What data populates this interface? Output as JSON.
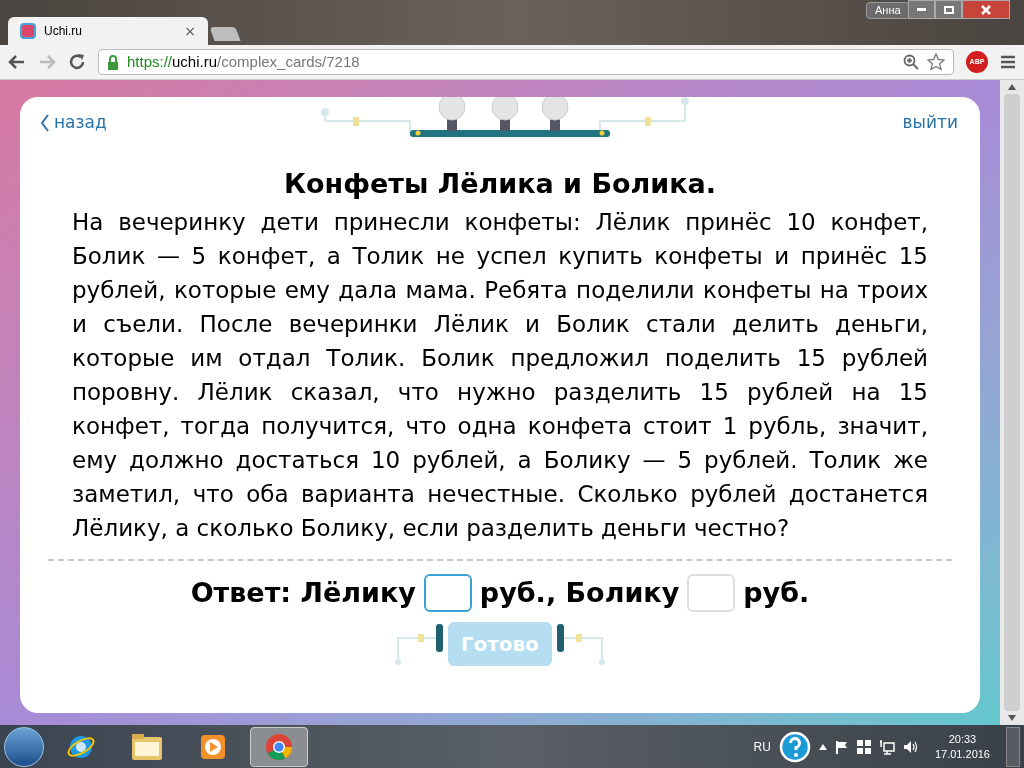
{
  "browser": {
    "user": "Анна",
    "tab": {
      "title": "Uchi.ru",
      "close": "×"
    },
    "url": {
      "scheme": "https://",
      "host": "uchi.ru",
      "path": "/complex_cards/7218"
    },
    "extension": "ABP"
  },
  "card": {
    "back": "назад",
    "exit": "выйти",
    "title": "Конфеты Лёлика и Болика.",
    "text": "На вечеринку дети принесли конфеты: Лёлик принёс 10 конфет, Болик — 5 конфет, а Толик не успел купить конфеты и принёс 15 рублей, которые ему дала мама. Ребята поделили конфеты на троих и съели. После вечеринки Лёлик и Болик стали делить деньги, которые им отдал Толик. Болик предложил поделить 15 рублей поровну. Лёлик сказал, что нужно разделить 15 рублей на 15 конфет, тогда получится, что одна конфета стоит 1 рубль, значит, ему должно достаться 10 рублей, а Болику — 5 рублей. Толик же заметил, что оба варианта нечестные. Сколько рублей достанется Лёлику, а сколько Болику, если разделить деньги честно?",
    "answer": [
      {
        "kind": "text",
        "text": "Ответ: Лёлику"
      },
      {
        "kind": "field",
        "focused": true
      },
      {
        "kind": "text",
        "text": "руб., Болику"
      },
      {
        "kind": "field",
        "focused": false
      },
      {
        "kind": "text",
        "text": "руб."
      }
    ],
    "submit": {
      "label": "Готово",
      "disabled": true
    }
  },
  "taskbar": {
    "apps": [
      {
        "kind": "ie",
        "selected": false
      },
      {
        "kind": "folder",
        "selected": false
      },
      {
        "kind": "media",
        "selected": false
      },
      {
        "kind": "chrome",
        "selected": true
      }
    ],
    "language": "RU",
    "time": "20:33",
    "date": "17.01.2016"
  }
}
